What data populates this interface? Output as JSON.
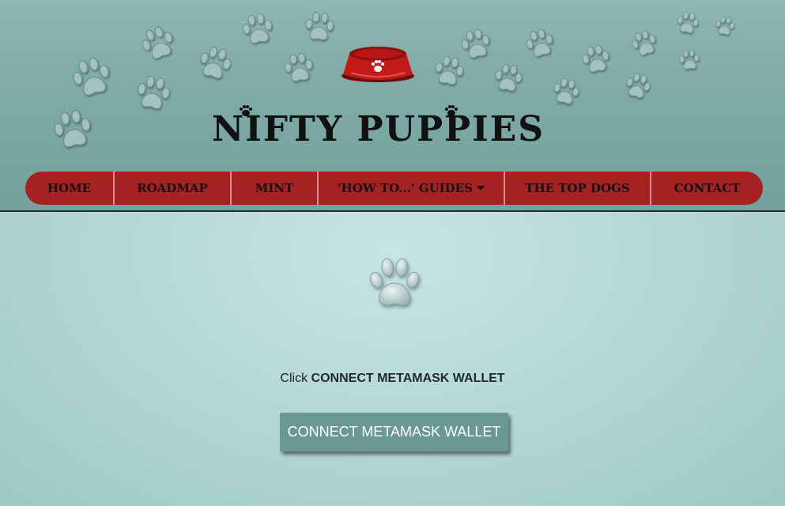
{
  "brand": {
    "logo_text": "NIFTY  PUPPIES"
  },
  "nav": {
    "items": [
      {
        "label": "HOME"
      },
      {
        "label": "ROADMAP"
      },
      {
        "label": "MINT"
      },
      {
        "label": "'HOW TO...' GUIDES",
        "has_dropdown": true
      },
      {
        "label": "THE TOP DOGS"
      },
      {
        "label": "CONTACT"
      }
    ]
  },
  "main": {
    "instruction_prefix": "Click",
    "instruction_strong": "CONNECT METAMASK WALLET",
    "connect_button_label": "CONNECT METAMASK WALLET"
  },
  "colors": {
    "header_bg": "#80aba7",
    "nav_bg": "#a62121",
    "button_bg": "#6a9894",
    "page_bg": "#c7e6e3"
  },
  "icons": {
    "decor": "paw-print-icon",
    "bowl": "dog-bowl-icon"
  }
}
